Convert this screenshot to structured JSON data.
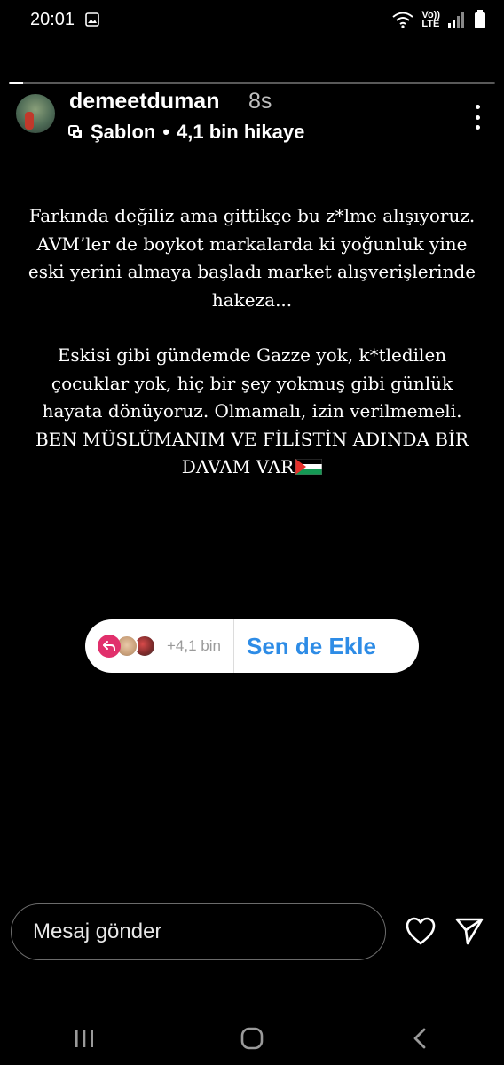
{
  "status_bar": {
    "time": "20:01",
    "network": "LTE",
    "network_top": "Vo))"
  },
  "story": {
    "progress": 0.03,
    "username": "demeetduman",
    "time_ago": "8s",
    "template_label": "Şablon",
    "separator": "•",
    "story_count": "4,1 bin hikaye",
    "text_paragraph_1": "Farkında değiliz ama gittikçe bu z*lme alışıyoruz. AVM’ler de boykot markalarda ki yoğunluk yine eski yerini almaya başladı market alışverişlerinde hakeza...",
    "text_paragraph_2": "Eskisi gibi gündemde Gazze yok, k*tledilen çocuklar yok, hiç bir şey yokmuş gibi günlük hayata dönüyoruz. Olmamalı, izin verilmemeli.",
    "text_paragraph_3": "BEN MÜSLÜMANIM VE FİLİSTİN ADINDA BİR DAVAM VAR",
    "flag_icon": "palestine-flag-icon"
  },
  "add_yours": {
    "count": "+4,1 bin",
    "label": "Sen de Ekle",
    "accent": "#e1306c",
    "label_color": "#2e8ce6"
  },
  "footer": {
    "message_placeholder": "Mesaj gönder",
    "like_icon": "heart-icon",
    "send_icon": "send-icon"
  },
  "nav": {
    "recents_icon": "recents-icon",
    "home_icon": "home-icon",
    "back_icon": "back-icon"
  }
}
